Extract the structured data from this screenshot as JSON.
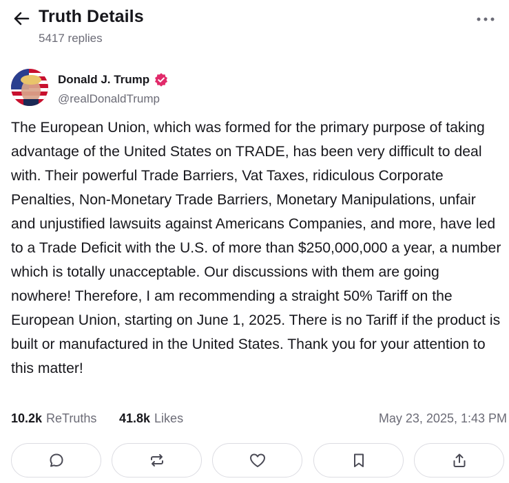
{
  "header": {
    "title": "Truth Details",
    "replies": "5417 replies"
  },
  "author": {
    "name": "Donald J. Trump",
    "handle": "@realDonaldTrump",
    "verified": true
  },
  "post": {
    "text": "The European Union, which was formed for the primary purpose of taking advantage of the United States on TRADE, has been very difficult to deal with. Their powerful Trade Barriers, Vat Taxes, ridiculous Corporate Penalties, Non-Monetary Trade Barriers, Monetary Manipulations, unfair and unjustified lawsuits against Americans Companies, and more, have led to a Trade Deficit with the U.S. of more than $250,000,000 a year, a number which is totally unacceptable. Our discussions with them are going nowhere! Therefore, I am recommending a straight 50% Tariff on the European Union, starting on June 1, 2025. There is no Tariff if the product is built or manufactured in the United States. Thank you for your attention to this matter!"
  },
  "stats": {
    "retruths_count": "10.2k",
    "retruths_label": "ReTruths",
    "likes_count": "41.8k",
    "likes_label": "Likes",
    "timestamp": "May 23, 2025, 1:43 PM"
  },
  "actions": [
    {
      "icon": "reply-icon"
    },
    {
      "icon": "retruth-icon"
    },
    {
      "icon": "heart-icon"
    },
    {
      "icon": "bookmark-icon"
    },
    {
      "icon": "share-icon"
    }
  ],
  "colors": {
    "text": "#17171c",
    "muted": "#6b6b76",
    "brand": "#e12a6a",
    "border": "#dcdce2"
  }
}
